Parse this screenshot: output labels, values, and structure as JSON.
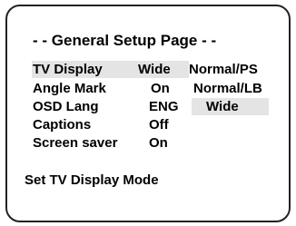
{
  "page": {
    "title": "- - General Setup Page - -"
  },
  "settings": [
    {
      "label": "TV Display",
      "value": "Wide"
    },
    {
      "label": "Angle Mark",
      "value": "On"
    },
    {
      "label": "OSD Lang",
      "value": "ENG"
    },
    {
      "label": "Captions",
      "value": "Off"
    },
    {
      "label": "Screen saver",
      "value": "On"
    }
  ],
  "options": [
    "Normal/PS",
    "Normal/LB",
    "Wide"
  ],
  "status": "Set TV Display Mode"
}
